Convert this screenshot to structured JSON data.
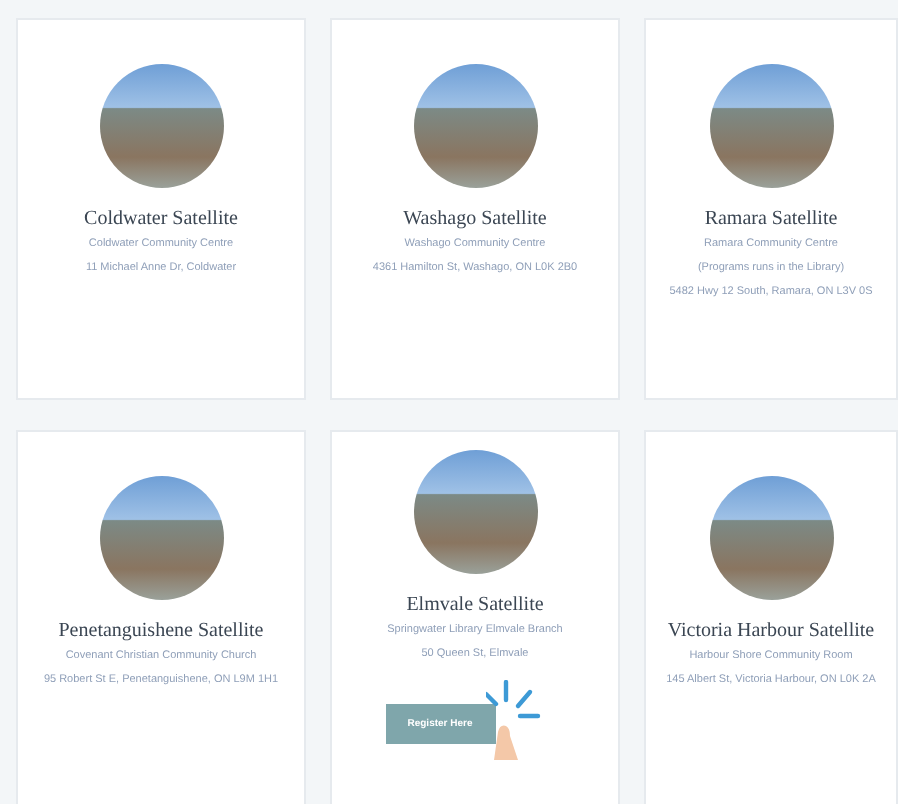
{
  "locations": [
    {
      "title": "Coldwater Satellite",
      "venue": "Coldwater Community Centre",
      "address": "11 Michael Anne Dr, Coldwater"
    },
    {
      "title": "Washago Satellite",
      "venue": "Washago Community Centre",
      "address": "4361 Hamilton St, Washago, ON L0K 2B0"
    },
    {
      "title": "Ramara Satellite",
      "venue": "Ramara Community Centre",
      "note": "(Programs runs in the Library)",
      "address": "5482 Hwy 12 South, Ramara, ON L3V 0S"
    },
    {
      "title": "Penetanguishene Satellite",
      "venue": "Covenant Christian Community Church",
      "address": "95 Robert St E, Penetanguishene, ON L9M 1H1"
    },
    {
      "title": "Elmvale Satellite",
      "venue": "Springwater Library Elmvale Branch",
      "address": "50 Queen St, Elmvale",
      "button": "Register Here"
    },
    {
      "title": "Victoria Harbour Satellite",
      "venue": "Harbour Shore Community Room",
      "address": "145 Albert St, Victoria Harbour, ON L0K 2A"
    }
  ]
}
